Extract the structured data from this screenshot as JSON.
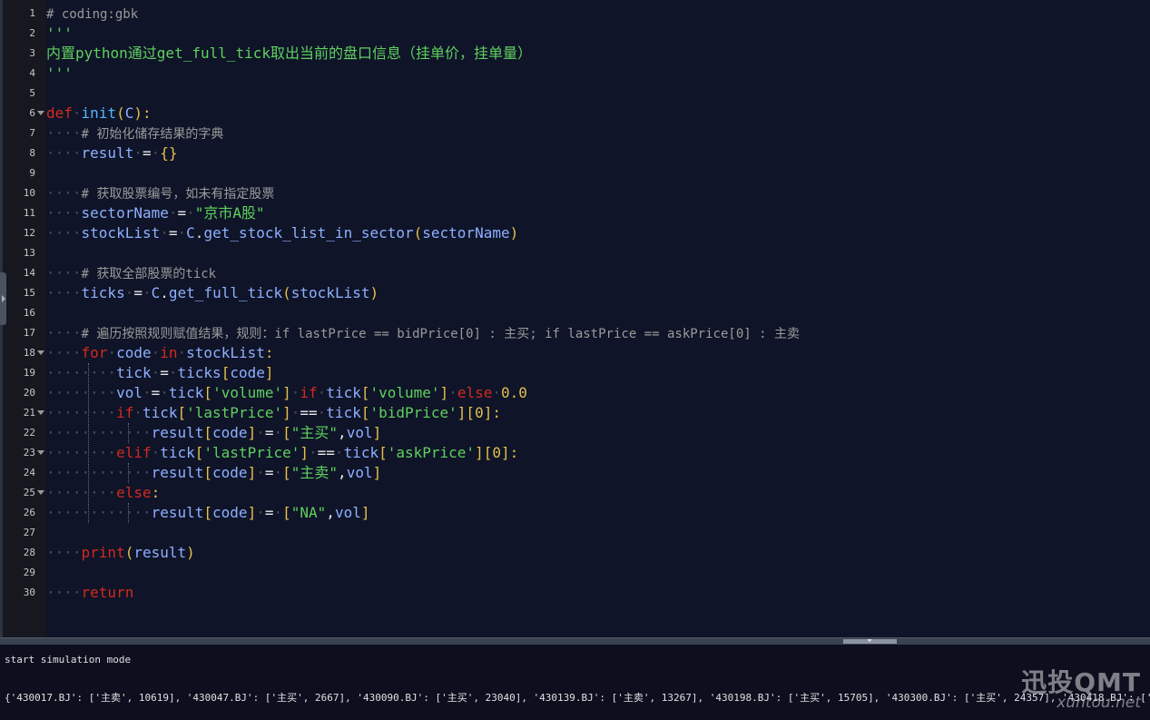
{
  "editor": {
    "line_numbers": [
      "1",
      "2",
      "3",
      "4",
      "5",
      "6",
      "7",
      "8",
      "9",
      "10",
      "11",
      "12",
      "13",
      "14",
      "15",
      "16",
      "17",
      "18",
      "19",
      "20",
      "21",
      "22",
      "23",
      "24",
      "25",
      "26",
      "27",
      "28",
      "29",
      "30"
    ],
    "lines": {
      "l1": {
        "a": "# coding:gbk"
      },
      "l2": {
        "a": "'''"
      },
      "l3": {
        "a": "内置python通过get_full_tick取出当前的盘口信息（挂单价，挂单量）"
      },
      "l4": {
        "a": "'''"
      },
      "l6": {
        "a": "def",
        "b": "init",
        "c": "(",
        "d": "C",
        "e": "):"
      },
      "l7": {
        "a": "# 初始化储存结果的字典"
      },
      "l8": {
        "a": "result",
        "b": "=",
        "c": "{}"
      },
      "l10": {
        "a": "# 获取股票编号，如未有指定股票"
      },
      "l11": {
        "a": "sectorName",
        "b": "=",
        "c": "\"京市A股\""
      },
      "l12": {
        "a": "stockList",
        "b": "=",
        "c": "C",
        "d": ".",
        "e": "get_stock_list_in_sector",
        "f": "(",
        "g": "sectorName",
        "h": ")"
      },
      "l14": {
        "a": "# 获取全部股票的tick"
      },
      "l15": {
        "a": "ticks",
        "b": "=",
        "c": "C",
        "d": ".",
        "e": "get_full_tick",
        "f": "(",
        "g": "stockList",
        "h": ")"
      },
      "l17": {
        "a": "# 遍历按照规则赋值结果，规则：if lastPrice == bidPrice[0] : 主买; if lastPrice == askPrice[0] : 主卖"
      },
      "l18": {
        "a": "for",
        "b": "code",
        "c": "in",
        "d": "stockList",
        "e": ":"
      },
      "l19": {
        "a": "tick",
        "b": "=",
        "c": "ticks",
        "d": "[",
        "e": "code",
        "f": "]"
      },
      "l20": {
        "a": "vol",
        "b": "=",
        "c": "tick",
        "d": "[",
        "e": "'volume'",
        "f": "]",
        "g": "if",
        "h": "tick",
        "i": "[",
        "j": "'volume'",
        "k": "]",
        "l": "else",
        "m": "0.0"
      },
      "l21": {
        "a": "if",
        "b": "tick",
        "c": "[",
        "d": "'lastPrice'",
        "e": "]",
        "f": "==",
        "g": "tick",
        "h": "[",
        "i": "'bidPrice'",
        "j": "][",
        "k": "0",
        "l": "]:"
      },
      "l22": {
        "a": "result",
        "b": "[",
        "c": "code",
        "d": "]",
        "e": "=",
        "f": "[",
        "g": "\"主买\"",
        "h": ",",
        "i": "vol",
        "j": "]"
      },
      "l23": {
        "a": "elif",
        "b": "tick",
        "c": "[",
        "d": "'lastPrice'",
        "e": "]",
        "f": "==",
        "g": "tick",
        "h": "[",
        "i": "'askPrice'",
        "j": "][",
        "k": "0",
        "l": "]:"
      },
      "l24": {
        "a": "result",
        "b": "[",
        "c": "code",
        "d": "]",
        "e": "=",
        "f": "[",
        "g": "\"主卖\"",
        "h": ",",
        "i": "vol",
        "j": "]"
      },
      "l25": {
        "a": "else",
        "b": ":"
      },
      "l26": {
        "a": "result",
        "b": "[",
        "c": "code",
        "d": "]",
        "e": "=",
        "f": "[",
        "g": "\"NA\"",
        "h": ",",
        "i": "vol",
        "j": "]"
      },
      "l28": {
        "a": "print",
        "b": "(",
        "c": "result",
        "d": ")"
      },
      "l30": {
        "a": "return"
      }
    }
  },
  "console": {
    "line1": "start simulation mode",
    "line2": "{'430017.BJ': ['主卖', 10619], '430047.BJ': ['主买', 2667], '430090.BJ': ['主买', 23040], '430139.BJ': ['主卖', 13267], '430198.BJ': ['主买', 15705], '430300.BJ': ['主买', 24357], '430418.BJ': ['主买', 3422], '4"
  },
  "watermark": {
    "brand": "迅投QMT",
    "url": "xuntou.net"
  },
  "colors": {
    "keyword": "#d22a1f",
    "function": "#56b6ff",
    "identifier": "#8fb0ff",
    "string": "#5fd05f",
    "bracket": "#e4c04c",
    "comment": "#9b9b9b",
    "editor_bg": "#0f1428",
    "gutter_bg": "#16171f"
  }
}
